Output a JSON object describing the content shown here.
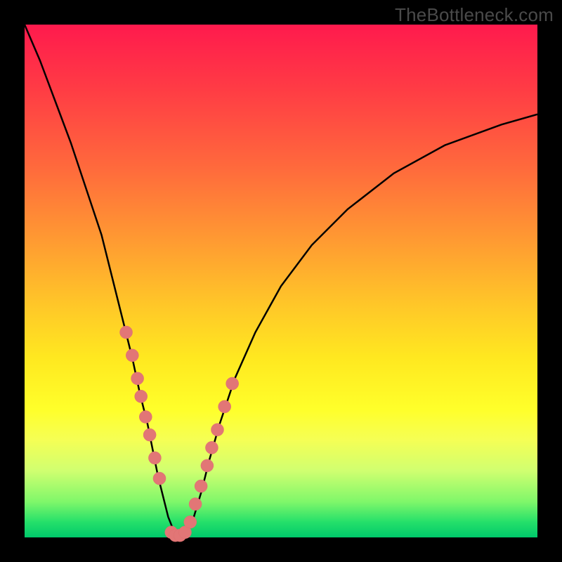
{
  "watermark": "TheBottleneck.com",
  "colors": {
    "dot": "#e27676",
    "curve": "#000000",
    "frame": "#000000"
  },
  "chart_data": {
    "type": "line",
    "title": "",
    "xlabel": "",
    "ylabel": "",
    "xlim": [
      0,
      100
    ],
    "ylim": [
      0,
      100
    ],
    "series": [
      {
        "name": "bottleneck-curve",
        "x": [
          0,
          3,
          6,
          9,
          12,
          15,
          17,
          19,
          21,
          22.5,
          24,
          25,
          26,
          27,
          28,
          29,
          30,
          31,
          32,
          33,
          34.5,
          36,
          38,
          41,
          45,
          50,
          56,
          63,
          72,
          82,
          93,
          100
        ],
        "y": [
          100,
          93,
          85,
          77,
          68,
          59,
          51,
          43,
          35,
          28,
          22,
          17,
          12,
          8,
          4,
          1.5,
          0.4,
          0.4,
          1.5,
          4,
          9,
          15,
          22,
          31,
          40,
          49,
          57,
          64,
          71,
          76.5,
          80.5,
          82.5
        ]
      }
    ],
    "highlight_points": {
      "name": "markers",
      "x": [
        19.8,
        21.0,
        22.0,
        22.7,
        23.6,
        24.4,
        25.4,
        26.3,
        28.6,
        29.4,
        30.3,
        31.3,
        32.3,
        33.3,
        34.4,
        35.6,
        36.5,
        37.6,
        39.0,
        40.5
      ],
      "y": [
        40,
        35.5,
        31,
        27.5,
        23.5,
        20,
        15.5,
        11.5,
        1,
        0.4,
        0.4,
        1,
        3,
        6.5,
        10,
        14,
        17.5,
        21,
        25.5,
        30
      ]
    }
  }
}
